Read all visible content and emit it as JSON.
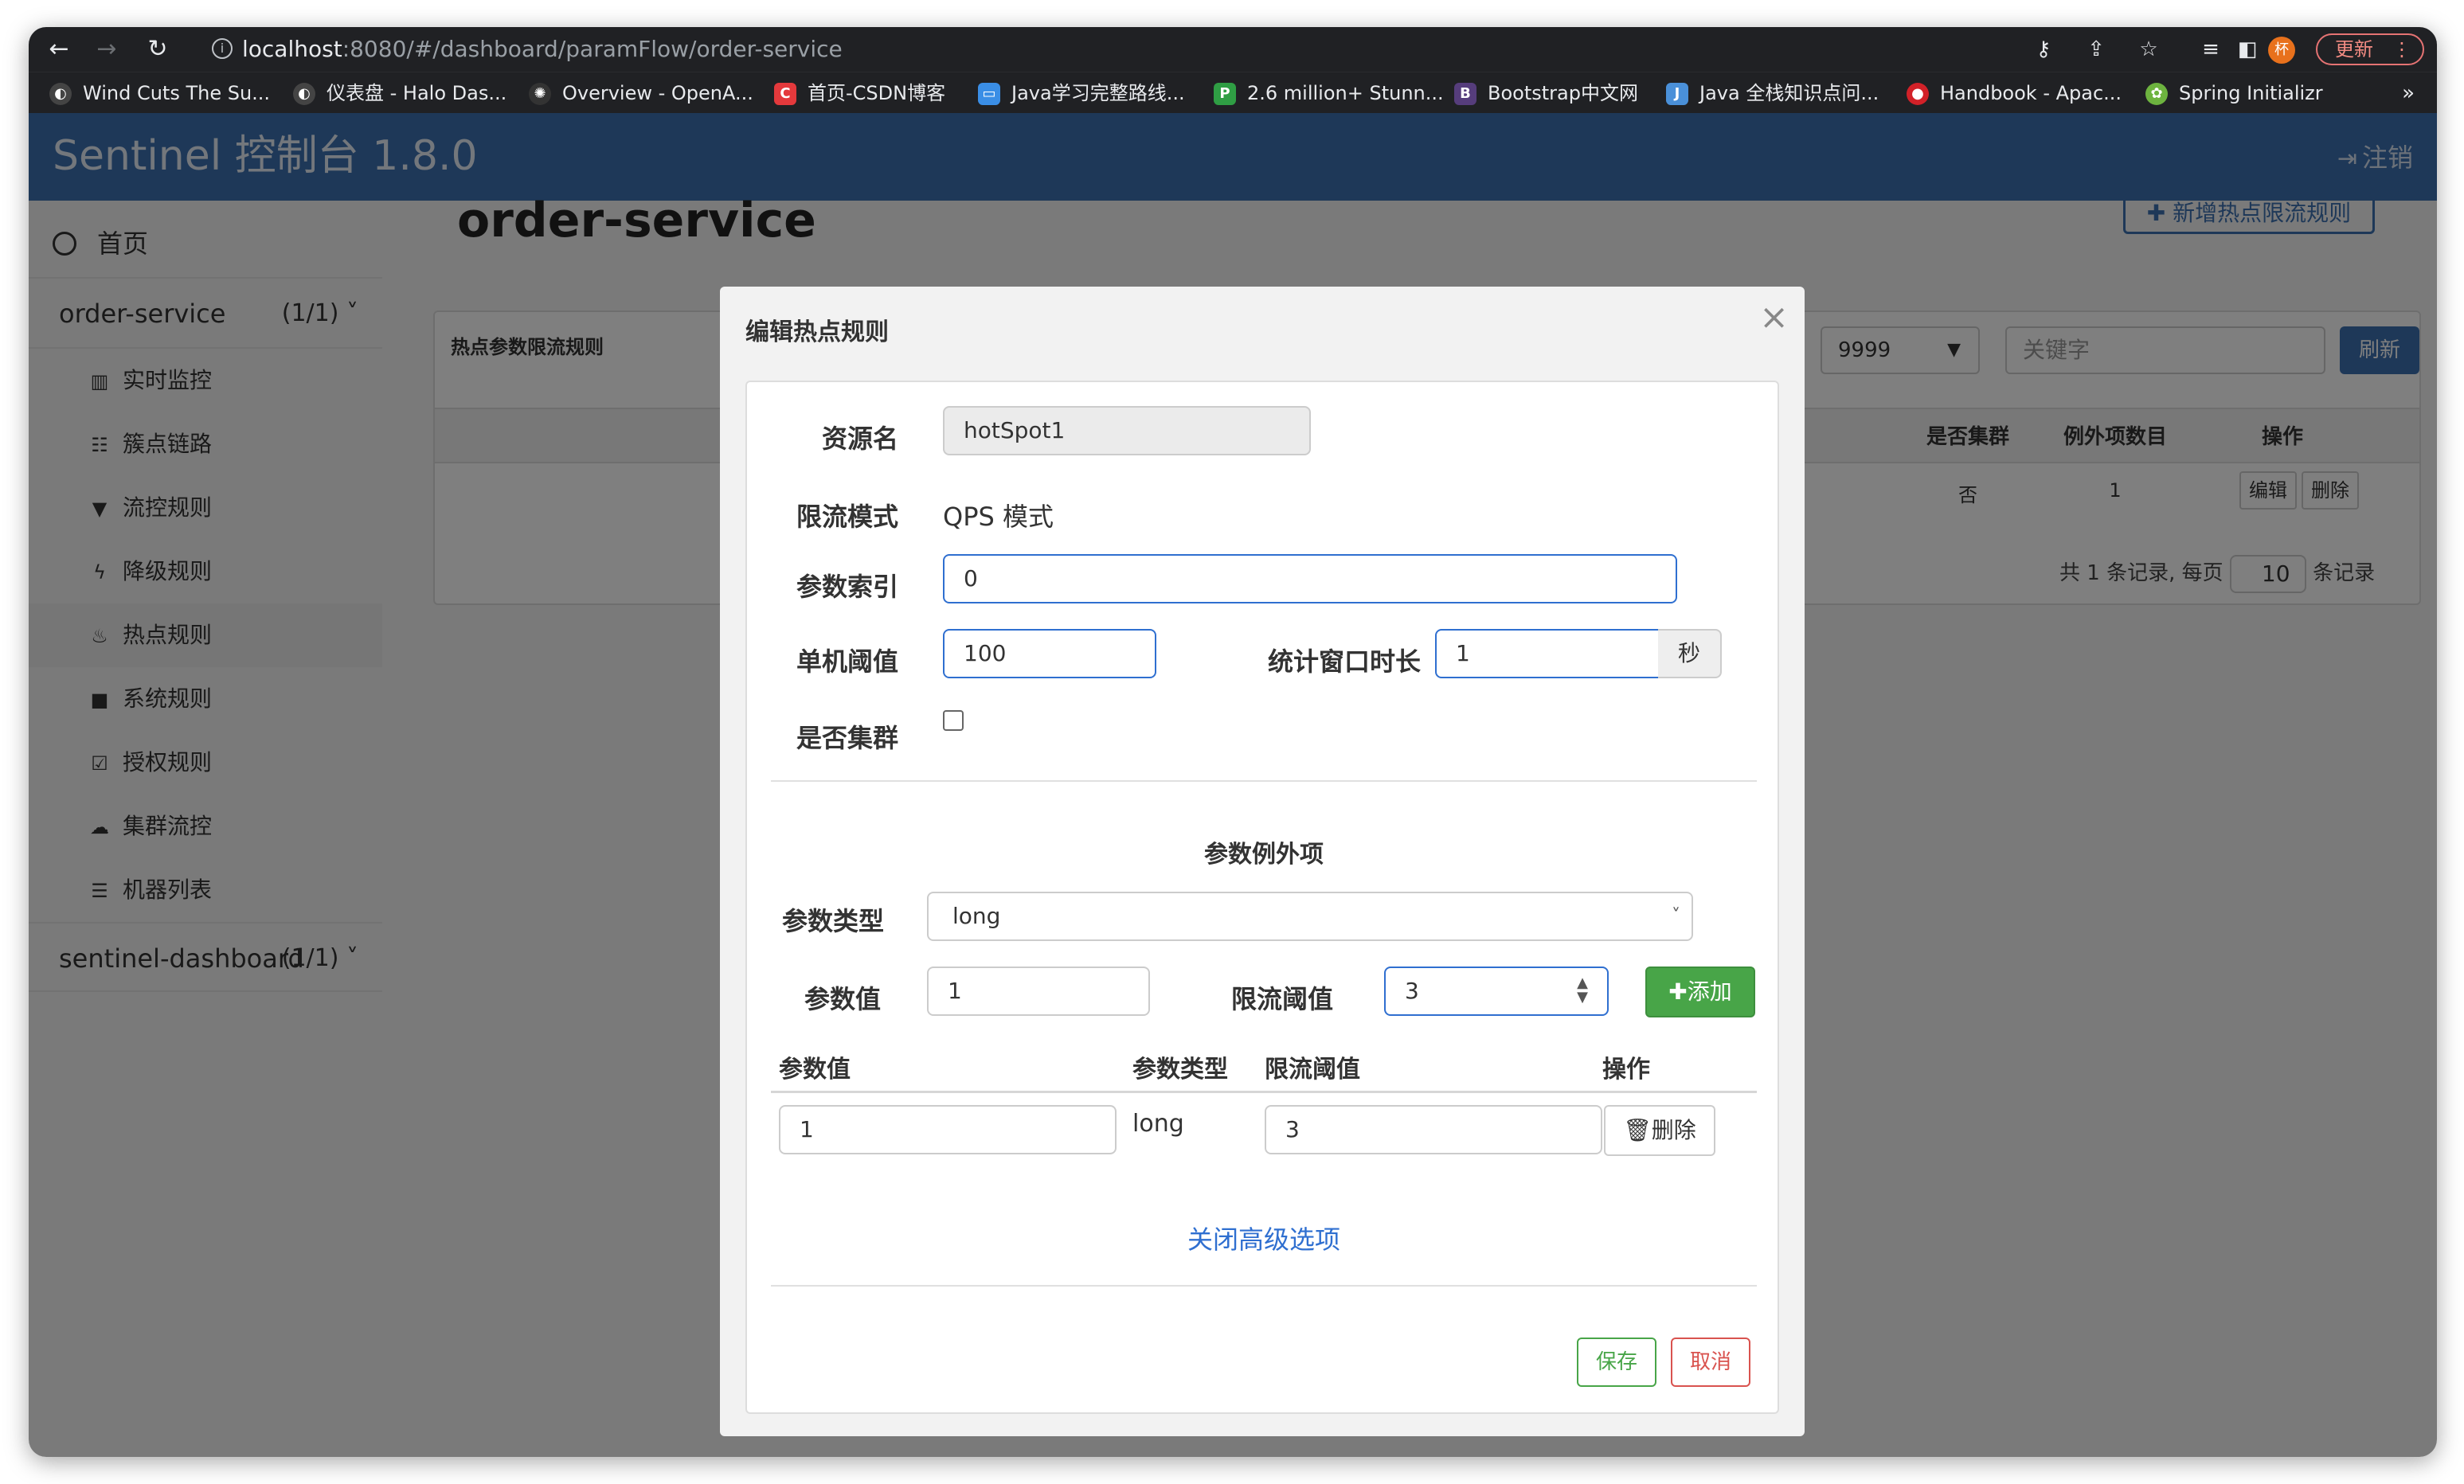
{
  "browser": {
    "url_host": "localhost",
    "url_rest": ":8080/#/dashboard/paramFlow/order-service",
    "update_label": "更新",
    "profile_initial": "杯",
    "bookmarks": [
      {
        "label": "Wind Cuts The Su...",
        "color": "#ffffff"
      },
      {
        "label": "仪表盘 - Halo Das...",
        "color": "#ffffff"
      },
      {
        "label": "Overview - OpenA...",
        "color": "#444444"
      },
      {
        "label": "首页-CSDN博客",
        "color": "#e4393c"
      },
      {
        "label": "Java学习完整路线...",
        "color": "#3a8ee6"
      },
      {
        "label": "2.6 million+ Stunn...",
        "color": "#2f9e44"
      },
      {
        "label": "Bootstrap中文网",
        "color": "#563d7c"
      },
      {
        "label": "Java 全栈知识点问...",
        "color": "#4a90d9"
      },
      {
        "label": "Handbook - Apac...",
        "color": "#d22128"
      },
      {
        "label": "Spring Initializr",
        "color": "#6db33f"
      }
    ]
  },
  "app": {
    "title": "Sentinel 控制台 1.8.0",
    "logout": "注销"
  },
  "sidebar": {
    "home": "首页",
    "app_name": "order-service",
    "app_count": "(1/1)",
    "items": [
      {
        "label": "实时监控",
        "icon": "bar-chart-icon"
      },
      {
        "label": "簇点链路",
        "icon": "list-icon"
      },
      {
        "label": "流控规则",
        "icon": "filter-icon"
      },
      {
        "label": "降级规则",
        "icon": "flash-icon"
      },
      {
        "label": "热点规则",
        "icon": "fire-icon"
      },
      {
        "label": "系统规则",
        "icon": "lock-icon"
      },
      {
        "label": "授权规则",
        "icon": "check-icon"
      },
      {
        "label": "集群流控",
        "icon": "cloud-icon"
      },
      {
        "label": "机器列表",
        "icon": "list-icon"
      }
    ],
    "app2_name": "sentinel-dashboard",
    "app2_count": "(1/1)"
  },
  "page": {
    "title": "order-service",
    "add_rule": "新增热点限流规则",
    "panel_title": "热点参数限流规则",
    "machine": "9999",
    "keyword_placeholder": "关键字",
    "refresh": "刷新",
    "columns": [
      "是否集群",
      "例外项数目",
      "操作"
    ],
    "row": {
      "cluster": "否",
      "exceptions": "1",
      "edit": "编辑",
      "delete": "删除"
    },
    "pager_prefix": "共 1 条记录, 每页",
    "page_size": "10",
    "pager_suffix": "条记录"
  },
  "modal": {
    "title": "编辑热点规则",
    "resource_label": "资源名",
    "resource_value": "hotSpot1",
    "mode_label": "限流模式",
    "mode_value": "QPS 模式",
    "param_index_label": "参数索引",
    "param_index_value": "0",
    "threshold_label": "单机阈值",
    "threshold_value": "100",
    "window_label": "统计窗口时长",
    "window_value": "1",
    "window_unit": "秒",
    "cluster_label": "是否集群",
    "adv_title": "参数例外项",
    "param_type_label": "参数类型",
    "param_type_value": "long",
    "param_value_label": "参数值",
    "param_value": "1",
    "limit_label": "限流阈值",
    "limit_value": "3",
    "add_label": "添加",
    "table_headers": [
      "参数值",
      "参数类型",
      "限流阈值",
      "操作"
    ],
    "exception_row": {
      "value": "1",
      "type": "long",
      "limit": "3",
      "delete": "删除"
    },
    "close_adv": "关闭高级选项",
    "save": "保存",
    "cancel": "取消"
  }
}
